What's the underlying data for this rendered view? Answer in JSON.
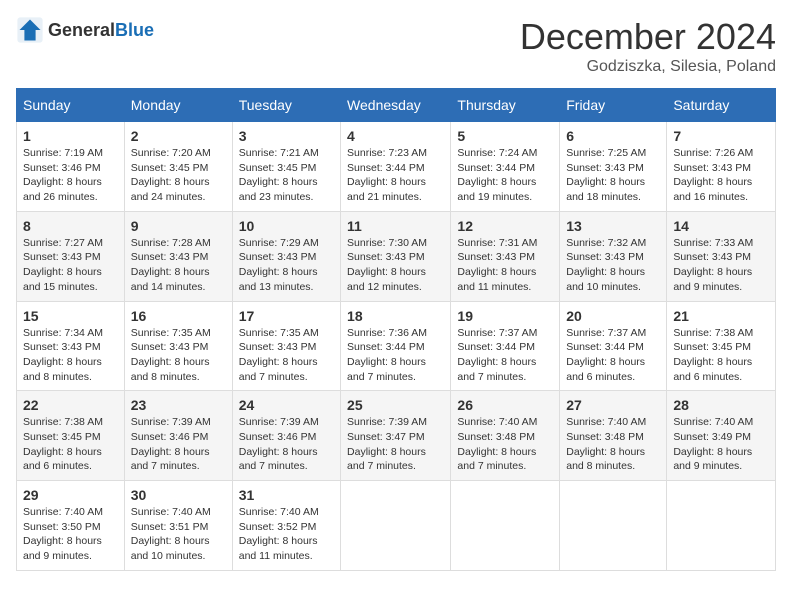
{
  "logo": {
    "general": "General",
    "blue": "Blue"
  },
  "title": {
    "month": "December 2024",
    "location": "Godziszka, Silesia, Poland"
  },
  "headers": [
    "Sunday",
    "Monday",
    "Tuesday",
    "Wednesday",
    "Thursday",
    "Friday",
    "Saturday"
  ],
  "weeks": [
    [
      {
        "day": "1",
        "sunrise": "Sunrise: 7:19 AM",
        "sunset": "Sunset: 3:46 PM",
        "daylight": "Daylight: 8 hours and 26 minutes."
      },
      {
        "day": "2",
        "sunrise": "Sunrise: 7:20 AM",
        "sunset": "Sunset: 3:45 PM",
        "daylight": "Daylight: 8 hours and 24 minutes."
      },
      {
        "day": "3",
        "sunrise": "Sunrise: 7:21 AM",
        "sunset": "Sunset: 3:45 PM",
        "daylight": "Daylight: 8 hours and 23 minutes."
      },
      {
        "day": "4",
        "sunrise": "Sunrise: 7:23 AM",
        "sunset": "Sunset: 3:44 PM",
        "daylight": "Daylight: 8 hours and 21 minutes."
      },
      {
        "day": "5",
        "sunrise": "Sunrise: 7:24 AM",
        "sunset": "Sunset: 3:44 PM",
        "daylight": "Daylight: 8 hours and 19 minutes."
      },
      {
        "day": "6",
        "sunrise": "Sunrise: 7:25 AM",
        "sunset": "Sunset: 3:43 PM",
        "daylight": "Daylight: 8 hours and 18 minutes."
      },
      {
        "day": "7",
        "sunrise": "Sunrise: 7:26 AM",
        "sunset": "Sunset: 3:43 PM",
        "daylight": "Daylight: 8 hours and 16 minutes."
      }
    ],
    [
      {
        "day": "8",
        "sunrise": "Sunrise: 7:27 AM",
        "sunset": "Sunset: 3:43 PM",
        "daylight": "Daylight: 8 hours and 15 minutes."
      },
      {
        "day": "9",
        "sunrise": "Sunrise: 7:28 AM",
        "sunset": "Sunset: 3:43 PM",
        "daylight": "Daylight: 8 hours and 14 minutes."
      },
      {
        "day": "10",
        "sunrise": "Sunrise: 7:29 AM",
        "sunset": "Sunset: 3:43 PM",
        "daylight": "Daylight: 8 hours and 13 minutes."
      },
      {
        "day": "11",
        "sunrise": "Sunrise: 7:30 AM",
        "sunset": "Sunset: 3:43 PM",
        "daylight": "Daylight: 8 hours and 12 minutes."
      },
      {
        "day": "12",
        "sunrise": "Sunrise: 7:31 AM",
        "sunset": "Sunset: 3:43 PM",
        "daylight": "Daylight: 8 hours and 11 minutes."
      },
      {
        "day": "13",
        "sunrise": "Sunrise: 7:32 AM",
        "sunset": "Sunset: 3:43 PM",
        "daylight": "Daylight: 8 hours and 10 minutes."
      },
      {
        "day": "14",
        "sunrise": "Sunrise: 7:33 AM",
        "sunset": "Sunset: 3:43 PM",
        "daylight": "Daylight: 8 hours and 9 minutes."
      }
    ],
    [
      {
        "day": "15",
        "sunrise": "Sunrise: 7:34 AM",
        "sunset": "Sunset: 3:43 PM",
        "daylight": "Daylight: 8 hours and 8 minutes."
      },
      {
        "day": "16",
        "sunrise": "Sunrise: 7:35 AM",
        "sunset": "Sunset: 3:43 PM",
        "daylight": "Daylight: 8 hours and 8 minutes."
      },
      {
        "day": "17",
        "sunrise": "Sunrise: 7:35 AM",
        "sunset": "Sunset: 3:43 PM",
        "daylight": "Daylight: 8 hours and 7 minutes."
      },
      {
        "day": "18",
        "sunrise": "Sunrise: 7:36 AM",
        "sunset": "Sunset: 3:44 PM",
        "daylight": "Daylight: 8 hours and 7 minutes."
      },
      {
        "day": "19",
        "sunrise": "Sunrise: 7:37 AM",
        "sunset": "Sunset: 3:44 PM",
        "daylight": "Daylight: 8 hours and 7 minutes."
      },
      {
        "day": "20",
        "sunrise": "Sunrise: 7:37 AM",
        "sunset": "Sunset: 3:44 PM",
        "daylight": "Daylight: 8 hours and 6 minutes."
      },
      {
        "day": "21",
        "sunrise": "Sunrise: 7:38 AM",
        "sunset": "Sunset: 3:45 PM",
        "daylight": "Daylight: 8 hours and 6 minutes."
      }
    ],
    [
      {
        "day": "22",
        "sunrise": "Sunrise: 7:38 AM",
        "sunset": "Sunset: 3:45 PM",
        "daylight": "Daylight: 8 hours and 6 minutes."
      },
      {
        "day": "23",
        "sunrise": "Sunrise: 7:39 AM",
        "sunset": "Sunset: 3:46 PM",
        "daylight": "Daylight: 8 hours and 7 minutes."
      },
      {
        "day": "24",
        "sunrise": "Sunrise: 7:39 AM",
        "sunset": "Sunset: 3:46 PM",
        "daylight": "Daylight: 8 hours and 7 minutes."
      },
      {
        "day": "25",
        "sunrise": "Sunrise: 7:39 AM",
        "sunset": "Sunset: 3:47 PM",
        "daylight": "Daylight: 8 hours and 7 minutes."
      },
      {
        "day": "26",
        "sunrise": "Sunrise: 7:40 AM",
        "sunset": "Sunset: 3:48 PM",
        "daylight": "Daylight: 8 hours and 7 minutes."
      },
      {
        "day": "27",
        "sunrise": "Sunrise: 7:40 AM",
        "sunset": "Sunset: 3:48 PM",
        "daylight": "Daylight: 8 hours and 8 minutes."
      },
      {
        "day": "28",
        "sunrise": "Sunrise: 7:40 AM",
        "sunset": "Sunset: 3:49 PM",
        "daylight": "Daylight: 8 hours and 9 minutes."
      }
    ],
    [
      {
        "day": "29",
        "sunrise": "Sunrise: 7:40 AM",
        "sunset": "Sunset: 3:50 PM",
        "daylight": "Daylight: 8 hours and 9 minutes."
      },
      {
        "day": "30",
        "sunrise": "Sunrise: 7:40 AM",
        "sunset": "Sunset: 3:51 PM",
        "daylight": "Daylight: 8 hours and 10 minutes."
      },
      {
        "day": "31",
        "sunrise": "Sunrise: 7:40 AM",
        "sunset": "Sunset: 3:52 PM",
        "daylight": "Daylight: 8 hours and 11 minutes."
      },
      null,
      null,
      null,
      null
    ]
  ]
}
